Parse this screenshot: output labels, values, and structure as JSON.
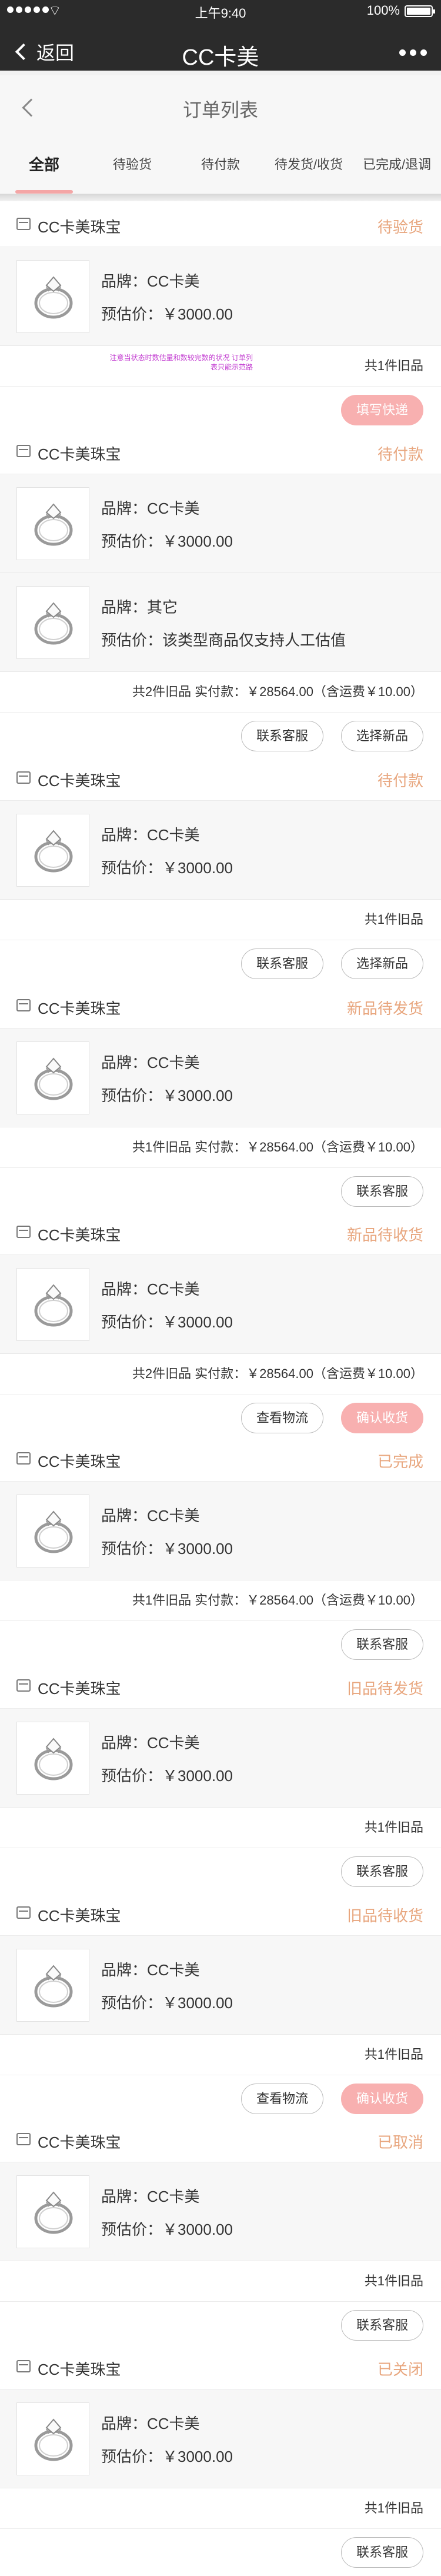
{
  "status_bar": {
    "time": "上午9:40",
    "battery": "100%",
    "battery_level": 1.0
  },
  "app_bar": {
    "back_label": "返回",
    "title": "CC卡美"
  },
  "page": {
    "title": "订单列表"
  },
  "tabs": [
    {
      "label": "全部",
      "active": true
    },
    {
      "label": "待验货",
      "active": false
    },
    {
      "label": "待付款",
      "active": false
    },
    {
      "label": "待发货/收货",
      "active": false
    },
    {
      "label": "已完成/退调",
      "active": false
    }
  ],
  "orders": [
    {
      "shop": "CC卡美珠宝",
      "status": "待验货",
      "items": [
        {
          "brand": "品牌：CC卡美",
          "price": "预估价：￥3000.00"
        }
      ],
      "note": "注意当状态时数估量和数较完数的状况 订单列表只能示范路",
      "summary": "共1件旧品",
      "buttons": [
        {
          "label": "填写快递",
          "style": "primary"
        }
      ]
    },
    {
      "shop": "CC卡美珠宝",
      "status": "待付款",
      "items": [
        {
          "brand": "品牌：CC卡美",
          "price": "预估价：￥3000.00"
        },
        {
          "brand": "品牌：其它",
          "price": "预估价：该类型商品仅支持人工估值"
        }
      ],
      "summary": "共2件旧品  实付款：￥28564.00（含运费￥10.00）",
      "buttons": [
        {
          "label": "联系客服",
          "style": "outline"
        },
        {
          "label": "选择新品",
          "style": "outline"
        }
      ]
    },
    {
      "shop": "CC卡美珠宝",
      "status": "待付款",
      "items": [
        {
          "brand": "品牌：CC卡美",
          "price": "预估价：￥3000.00"
        }
      ],
      "summary": "共1件旧品",
      "buttons": [
        {
          "label": "联系客服",
          "style": "outline"
        },
        {
          "label": "选择新品",
          "style": "outline"
        }
      ]
    },
    {
      "shop": "CC卡美珠宝",
      "status": "新品待发货",
      "items": [
        {
          "brand": "品牌：CC卡美",
          "price": "预估价：￥3000.00"
        }
      ],
      "summary": "共1件旧品  实付款：￥28564.00（含运费￥10.00）",
      "buttons": [
        {
          "label": "联系客服",
          "style": "outline"
        }
      ]
    },
    {
      "shop": "CC卡美珠宝",
      "status": "新品待收货",
      "items": [
        {
          "brand": "品牌：CC卡美",
          "price": "预估价：￥3000.00"
        }
      ],
      "summary": "共2件旧品  实付款：￥28564.00（含运费￥10.00）",
      "buttons": [
        {
          "label": "查看物流",
          "style": "outline"
        },
        {
          "label": "确认收货",
          "style": "primary"
        }
      ]
    },
    {
      "shop": "CC卡美珠宝",
      "status": "已完成",
      "items": [
        {
          "brand": "品牌：CC卡美",
          "price": "预估价：￥3000.00"
        }
      ],
      "summary": "共1件旧品  实付款：￥28564.00（含运费￥10.00）",
      "buttons": [
        {
          "label": "联系客服",
          "style": "outline"
        }
      ]
    },
    {
      "shop": "CC卡美珠宝",
      "status": "旧品待发货",
      "items": [
        {
          "brand": "品牌：CC卡美",
          "price": "预估价：￥3000.00"
        }
      ],
      "summary": "共1件旧品",
      "buttons": [
        {
          "label": "联系客服",
          "style": "outline"
        }
      ]
    },
    {
      "shop": "CC卡美珠宝",
      "status": "旧品待收货",
      "items": [
        {
          "brand": "品牌：CC卡美",
          "price": "预估价：￥3000.00"
        }
      ],
      "summary": "共1件旧品",
      "buttons": [
        {
          "label": "查看物流",
          "style": "outline"
        },
        {
          "label": "确认收货",
          "style": "primary"
        }
      ]
    },
    {
      "shop": "CC卡美珠宝",
      "status": "已取消",
      "items": [
        {
          "brand": "品牌：CC卡美",
          "price": "预估价：￥3000.00"
        }
      ],
      "summary": "共1件旧品",
      "buttons": [
        {
          "label": "联系客服",
          "style": "outline"
        }
      ]
    },
    {
      "shop": "CC卡美珠宝",
      "status": "已关闭",
      "items": [
        {
          "brand": "品牌：CC卡美",
          "price": "预估价：￥3000.00"
        }
      ],
      "summary": "共1件旧品",
      "buttons": [
        {
          "label": "联系客服",
          "style": "outline"
        }
      ]
    }
  ],
  "colors": {
    "topbar": "#2b2b2b",
    "accent_pink": "#f8b0b0",
    "status_orange": "#e8a67e",
    "note_magenta": "#c23ad0"
  },
  "icons": {
    "shop": "shop-icon",
    "back": "chevron-left-icon",
    "more": "more-dots-icon",
    "product": "ring-icon"
  }
}
